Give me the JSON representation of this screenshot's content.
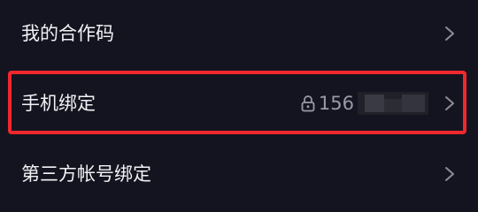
{
  "settings": {
    "rows": [
      {
        "label": "我的合作码",
        "icon": "chevron-right-icon"
      },
      {
        "label": "手机绑定",
        "value_prefix": "156",
        "value_masked": true,
        "value_icon": "lock-icon",
        "icon": "chevron-right-icon"
      },
      {
        "label": "第三方帐号绑定",
        "icon": "chevron-right-icon"
      }
    ],
    "highlight_color": "#f0282e",
    "background_color": "#141420",
    "text_color": "#f2f2f5",
    "secondary_text_color": "#9a9aa6"
  }
}
